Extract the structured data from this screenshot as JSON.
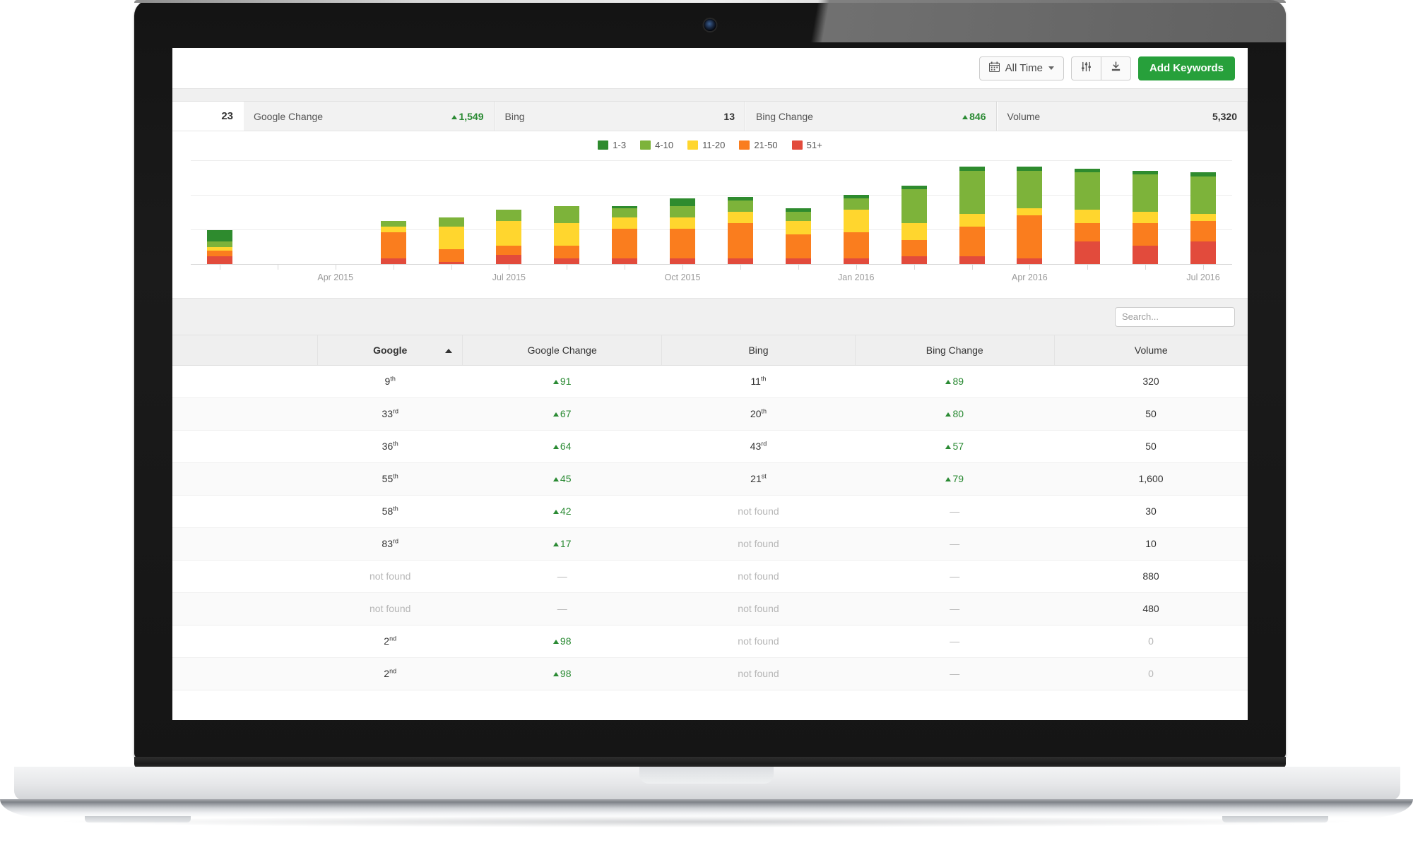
{
  "toolbar": {
    "date_filter_label": "All Time",
    "calendar_icon": "calendar-icon",
    "settings_icon": "sliders-icon",
    "download_icon": "download-icon",
    "add_keywords_label": "Add Keywords"
  },
  "stats": {
    "lead_number": "23",
    "cells": [
      {
        "label": "Google Change",
        "value": "1,549",
        "direction": "up"
      },
      {
        "label": "Bing",
        "value": "13",
        "direction": "none"
      },
      {
        "label": "Bing Change",
        "value": "846",
        "direction": "up"
      },
      {
        "label": "Volume",
        "value": "5,320",
        "direction": "none"
      }
    ]
  },
  "legend": [
    {
      "label": "1-3",
      "color": "#2e8b2e"
    },
    {
      "label": "4-10",
      "color": "#7db33a"
    },
    {
      "label": "11-20",
      "color": "#ffd62e"
    },
    {
      "label": "21-50",
      "color": "#fa7d1e"
    },
    {
      "label": "51+",
      "color": "#e24b3c"
    }
  ],
  "chart_data": {
    "type": "bar",
    "stacked": true,
    "title": "",
    "xlabel": "",
    "ylabel": "",
    "grid": true,
    "legend_position": "top-center",
    "axis_tick_labels": [
      "Apr 2015",
      "Jul 2015",
      "Oct 2015",
      "Jan 2016",
      "Apr 2016",
      "Jul 2016"
    ],
    "categories": [
      "Feb 2015",
      "Mar 2015",
      "Apr 2015",
      "May 2015",
      "Jun 2015",
      "Jul 2015",
      "Aug 2015",
      "Sep 2015",
      "Oct 2015",
      "Nov 2015",
      "Dec 2015",
      "Jan 2016",
      "Feb 2016",
      "Mar 2016",
      "Apr 2016",
      "May 2016",
      "Jun 2016",
      "Jul 2016"
    ],
    "series": [
      {
        "name": "51+",
        "color": "#e24b3c",
        "values": [
          4,
          0,
          0,
          3,
          1,
          5,
          3,
          3,
          3,
          3,
          3,
          3,
          4,
          4,
          3,
          12,
          10,
          12
        ]
      },
      {
        "name": "21-50",
        "color": "#fa7d1e",
        "values": [
          3,
          0,
          0,
          14,
          7,
          5,
          7,
          16,
          16,
          19,
          13,
          14,
          9,
          16,
          23,
          10,
          12,
          11
        ]
      },
      {
        "name": "11-20",
        "color": "#ffd62e",
        "values": [
          2,
          0,
          0,
          3,
          12,
          13,
          12,
          6,
          6,
          6,
          7,
          12,
          9,
          7,
          4,
          7,
          6,
          4
        ]
      },
      {
        "name": "4-10",
        "color": "#7db33a",
        "values": [
          3,
          0,
          0,
          3,
          5,
          6,
          9,
          5,
          6,
          6,
          5,
          6,
          18,
          23,
          20,
          20,
          20,
          20
        ]
      },
      {
        "name": "1-3",
        "color": "#2e8b2e",
        "values": [
          6,
          0,
          0,
          0,
          0,
          0,
          0,
          1,
          4,
          2,
          2,
          2,
          2,
          2,
          2,
          2,
          2,
          2
        ]
      }
    ]
  },
  "search": {
    "placeholder": "Search..."
  },
  "table": {
    "columns": [
      "",
      "Google",
      "Google Change",
      "Bing",
      "Bing Change",
      "Volume"
    ],
    "sorted_column": "Google",
    "sort_direction": "asc",
    "rows": [
      {
        "google": "9",
        "google_sup": "th",
        "google_change": "91",
        "google_change_dir": "up",
        "bing": "11",
        "bing_sup": "th",
        "bing_change": "89",
        "bing_change_dir": "up",
        "volume": "320",
        "volume_muted": false
      },
      {
        "google": "33",
        "google_sup": "rd",
        "google_change": "67",
        "google_change_dir": "up",
        "bing": "20",
        "bing_sup": "th",
        "bing_change": "80",
        "bing_change_dir": "up",
        "volume": "50",
        "volume_muted": false
      },
      {
        "google": "36",
        "google_sup": "th",
        "google_change": "64",
        "google_change_dir": "up",
        "bing": "43",
        "bing_sup": "rd",
        "bing_change": "57",
        "bing_change_dir": "up",
        "volume": "50",
        "volume_muted": false
      },
      {
        "google": "55",
        "google_sup": "th",
        "google_change": "45",
        "google_change_dir": "up",
        "bing": "21",
        "bing_sup": "st",
        "bing_change": "79",
        "bing_change_dir": "up",
        "volume": "1,600",
        "volume_muted": false
      },
      {
        "google": "58",
        "google_sup": "th",
        "google_change": "42",
        "google_change_dir": "up",
        "bing": "not found",
        "bing_sup": "",
        "bing_change": "—",
        "bing_change_dir": "none",
        "volume": "30",
        "volume_muted": false
      },
      {
        "google": "83",
        "google_sup": "rd",
        "google_change": "17",
        "google_change_dir": "up",
        "bing": "not found",
        "bing_sup": "",
        "bing_change": "—",
        "bing_change_dir": "none",
        "volume": "10",
        "volume_muted": false
      },
      {
        "google": "not found",
        "google_sup": "",
        "google_change": "—",
        "google_change_dir": "none",
        "bing": "not found",
        "bing_sup": "",
        "bing_change": "—",
        "bing_change_dir": "none",
        "volume": "880",
        "volume_muted": false
      },
      {
        "google": "not found",
        "google_sup": "",
        "google_change": "—",
        "google_change_dir": "none",
        "bing": "not found",
        "bing_sup": "",
        "bing_change": "—",
        "bing_change_dir": "none",
        "volume": "480",
        "volume_muted": false
      },
      {
        "google": "2",
        "google_sup": "nd",
        "google_change": "98",
        "google_change_dir": "up",
        "bing": "not found",
        "bing_sup": "",
        "bing_change": "—",
        "bing_change_dir": "none",
        "volume": "0",
        "volume_muted": true
      },
      {
        "google": "2",
        "google_sup": "nd",
        "google_change": "98",
        "google_change_dir": "up",
        "bing": "not found",
        "bing_sup": "",
        "bing_change": "—",
        "bing_change_dir": "none",
        "volume": "0",
        "volume_muted": true
      }
    ]
  }
}
